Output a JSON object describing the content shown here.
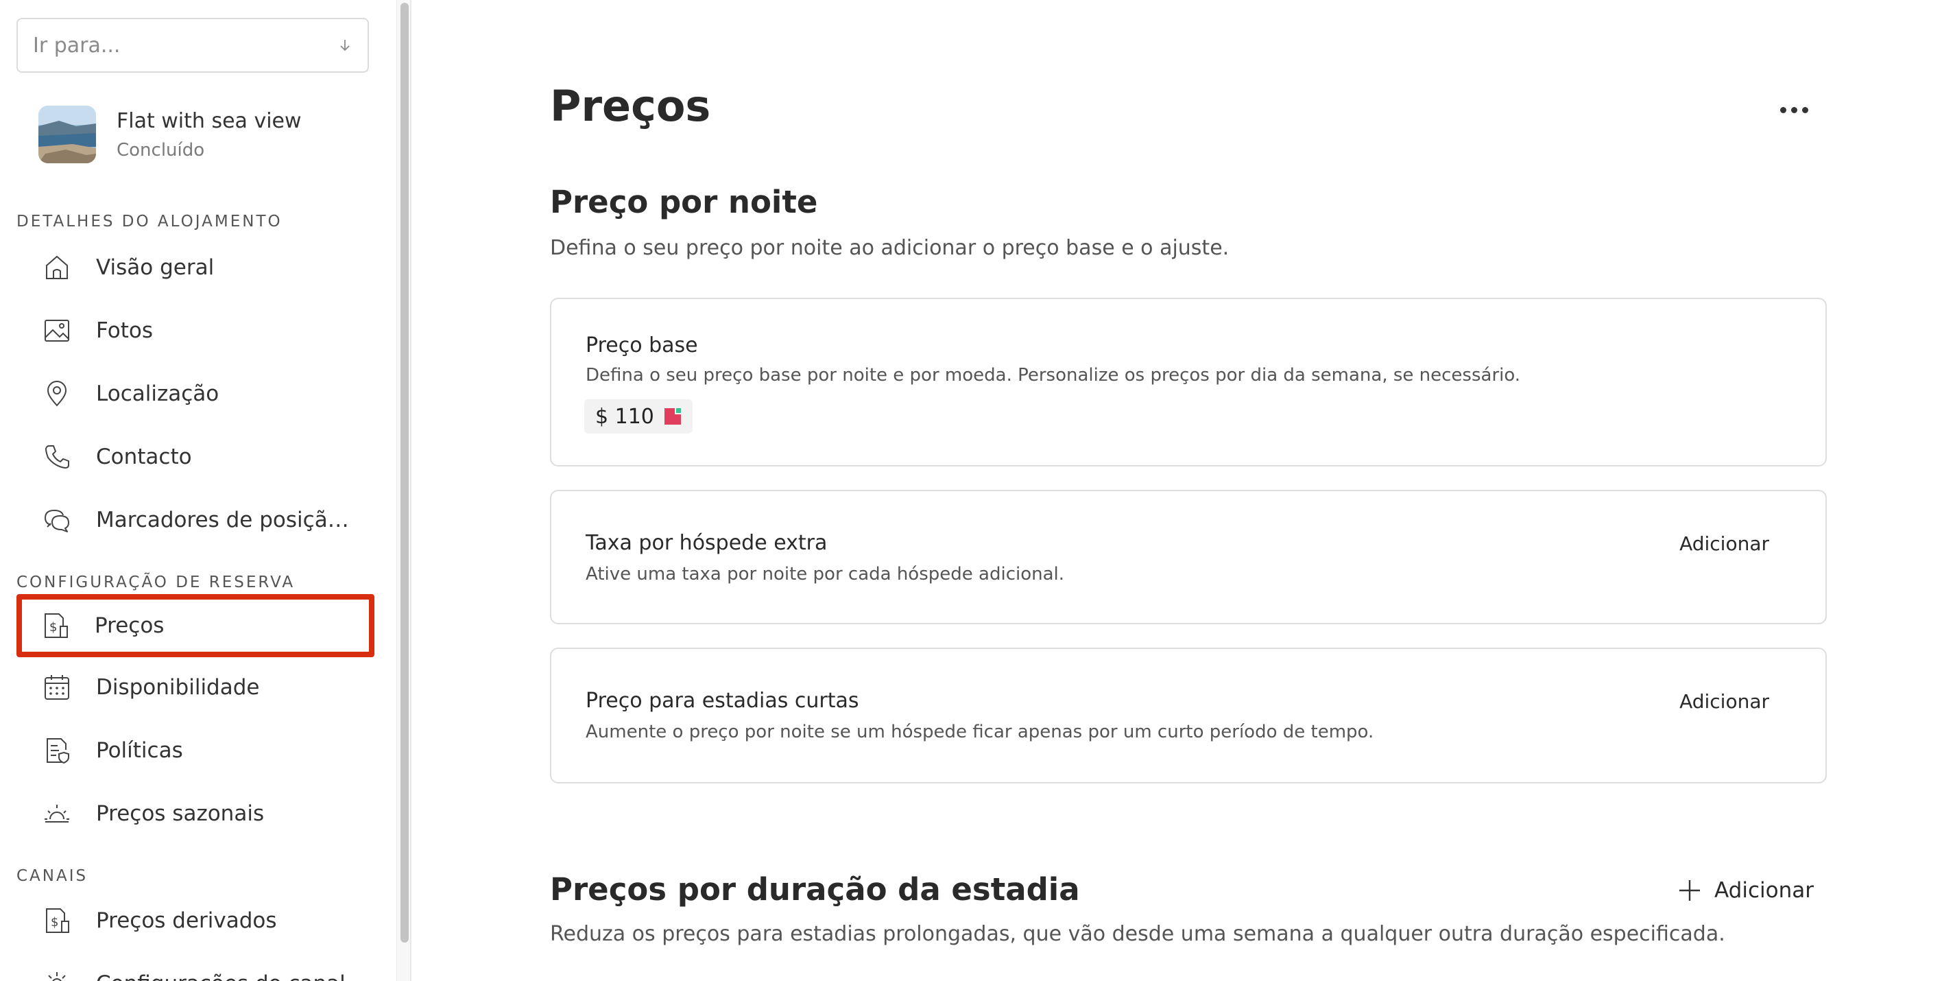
{
  "sidebar": {
    "goto_placeholder": "Ir para...",
    "listing": {
      "name": "Flat with sea view",
      "status": "Concluído"
    },
    "sections": [
      {
        "label": "DETALHES DO ALOJAMENTO"
      },
      {
        "label": "CONFIGURAÇÃO DE RESERVA"
      },
      {
        "label": "CANAIS"
      }
    ],
    "items": [
      {
        "label": "Visão geral",
        "icon": "home-icon"
      },
      {
        "label": "Fotos",
        "icon": "image-icon"
      },
      {
        "label": "Localização",
        "icon": "location-pin-icon"
      },
      {
        "label": "Contacto",
        "icon": "phone-icon"
      },
      {
        "label": "Marcadores de posição de mensagem",
        "icon": "chat-bubbles-icon"
      },
      {
        "label": "Preços",
        "icon": "price-tag-icon",
        "selected": true
      },
      {
        "label": "Disponibilidade",
        "icon": "calendar-icon"
      },
      {
        "label": "Políticas",
        "icon": "policy-document-icon"
      },
      {
        "label": "Preços sazonais",
        "icon": "sun-icon"
      },
      {
        "label": "Preços derivados",
        "icon": "price-tag-icon"
      },
      {
        "label": "Configurações do canal",
        "icon": "settings-icon"
      }
    ]
  },
  "main": {
    "title": "Preços",
    "nightly": {
      "title": "Preço por noite",
      "subtitle": "Defina o seu preço por noite ao adicionar o preço base e o ajuste."
    },
    "base_price": {
      "title": "Preço base",
      "description": "Defina o seu preço base por noite e por moeda. Personalize os preços por dia da semana, se necessário.",
      "value": "$ 110"
    },
    "extra_guest": {
      "title": "Taxa por hóspede extra",
      "description": "Ative uma taxa por noite por cada hóspede adicional.",
      "action": "Adicionar"
    },
    "short_stay": {
      "title": "Preço para estadias curtas",
      "description": "Aumente o preço por noite se um hóspede ficar apenas por um curto período de tempo.",
      "action": "Adicionar"
    },
    "length_of_stay": {
      "title": "Preços por duração da estadia",
      "subtitle": "Reduza os preços para estadias prolongadas, que vão desde uma semana a qualquer outra duração especificada.",
      "action": "Adicionar"
    }
  },
  "colors": {
    "highlight": "#d92d10",
    "flag_red": "#e03d5f",
    "flag_green": "#3cbf8f"
  }
}
